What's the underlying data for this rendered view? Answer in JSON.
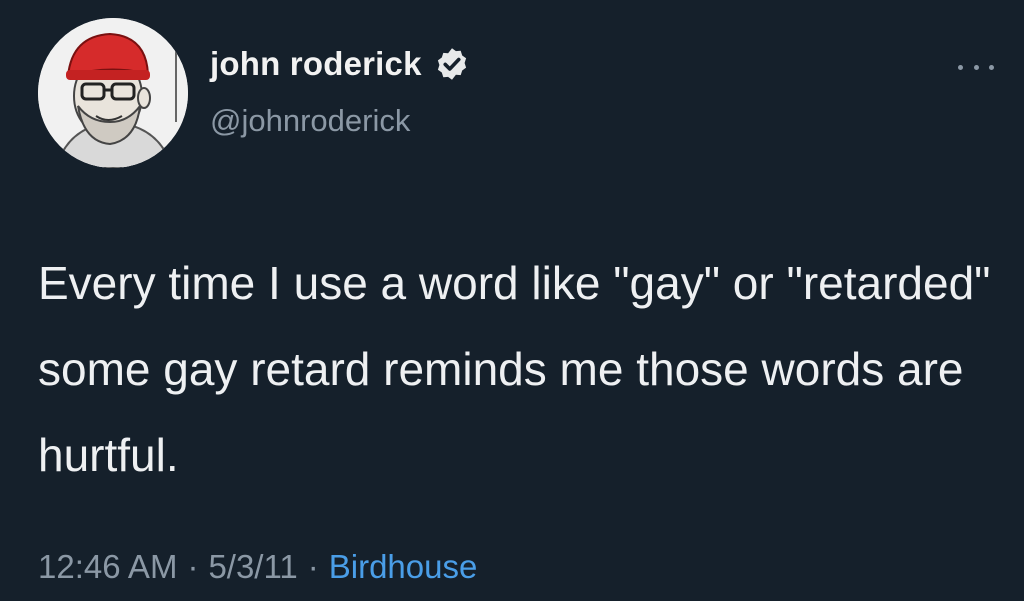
{
  "tweet": {
    "author": {
      "display_name": "john roderick",
      "handle": "@johnroderick",
      "verified": true,
      "avatar_icon": "cartoon-portrait-avatar"
    },
    "more_icon": "more-options-icon",
    "text": "Every time I use a word like \"gay\" or \"retarded\" some gay retard reminds me those words are hurtful.",
    "time": "12:46 AM",
    "date": "5/3/11",
    "separator": "·",
    "source": "Birdhouse"
  },
  "colors": {
    "background": "#15202b",
    "primary_text": "#eef0f2",
    "secondary_text": "#8b98a5",
    "link": "#4a9ee8",
    "verified_badge": "#e7e9ea"
  }
}
